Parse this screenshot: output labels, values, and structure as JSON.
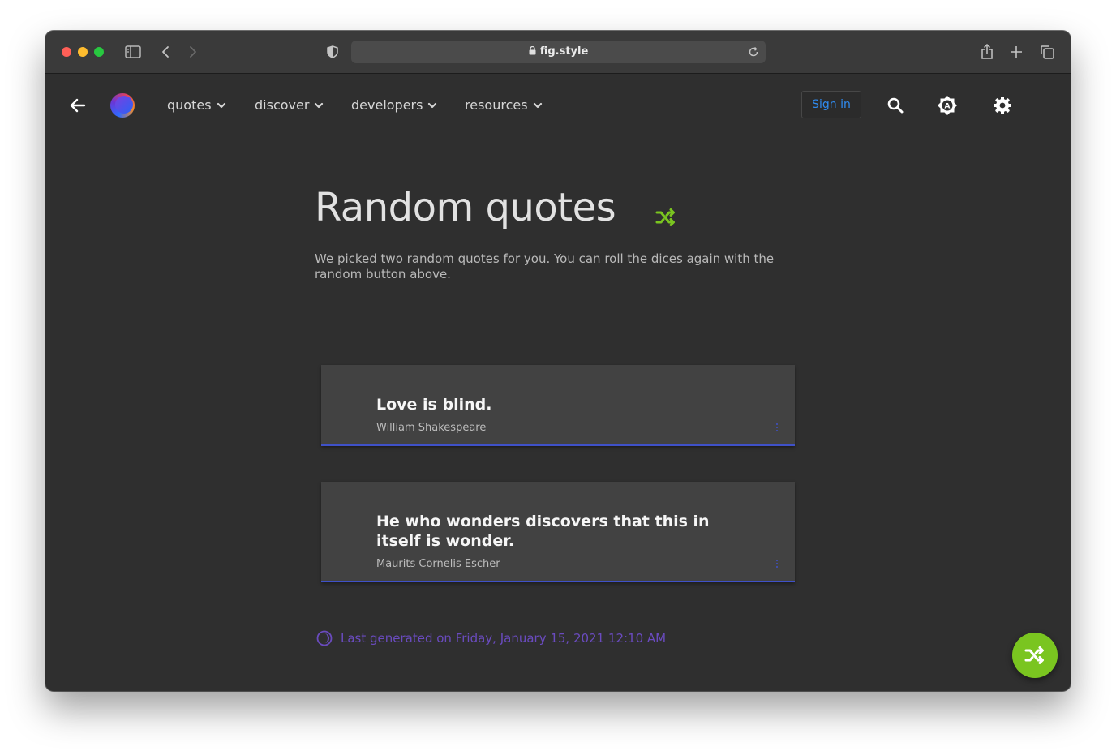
{
  "browser": {
    "url": "fig.style"
  },
  "nav": {
    "items": [
      {
        "label": "quotes"
      },
      {
        "label": "discover"
      },
      {
        "label": "developers"
      },
      {
        "label": "resources"
      }
    ],
    "signin_label": "Sign in"
  },
  "page": {
    "title": "Random quotes",
    "subtitle": "We picked two random quotes for you. You can roll the dices again with the random button above."
  },
  "quotes": [
    {
      "text": "Love is blind.",
      "author": "William Shakespeare"
    },
    {
      "text": "He who wonders discovers that this in itself is wonder.",
      "author": "Maurits Cornelis Escher"
    }
  ],
  "footer": {
    "last_generated": "Last generated on Friday, January 15, 2021 12:10 AM"
  },
  "colors": {
    "accent_green": "#7ac520",
    "link_blue": "#2f8bf0",
    "card_border": "#3f51c8",
    "footer_purple": "#6a4bbf"
  }
}
